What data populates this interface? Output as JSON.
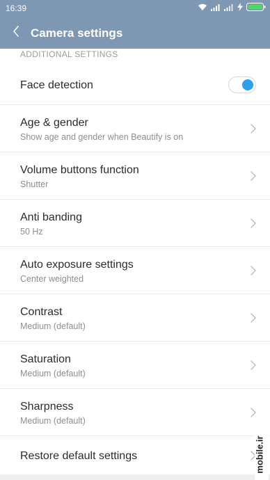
{
  "status": {
    "time": "16:39"
  },
  "header": {
    "title": "Camera settings"
  },
  "section": {
    "label": "ADDITIONAL SETTINGS"
  },
  "settings": [
    {
      "title": "Face detection",
      "subtitle": "",
      "control": "toggle",
      "enabled": true
    },
    {
      "title": "Age & gender",
      "subtitle": "Show age and gender when Beautify is on",
      "control": "chevron"
    },
    {
      "title": "Volume buttons function",
      "subtitle": "Shutter",
      "control": "chevron"
    },
    {
      "title": "Anti banding",
      "subtitle": "50 Hz",
      "control": "chevron"
    },
    {
      "title": "Auto exposure settings",
      "subtitle": "Center weighted",
      "control": "chevron"
    },
    {
      "title": "Contrast",
      "subtitle": "Medium (default)",
      "control": "chevron"
    },
    {
      "title": "Saturation",
      "subtitle": "Medium (default)",
      "control": "chevron"
    },
    {
      "title": "Sharpness",
      "subtitle": "Medium (default)",
      "control": "chevron"
    },
    {
      "title": "Restore default settings",
      "subtitle": "",
      "control": "chevron"
    }
  ],
  "watermark": {
    "text": "mobile.ir"
  },
  "colors": {
    "app_bar": "#7e97b3",
    "toggle_on": "#2aa0ef",
    "battery": "#4cd964"
  }
}
